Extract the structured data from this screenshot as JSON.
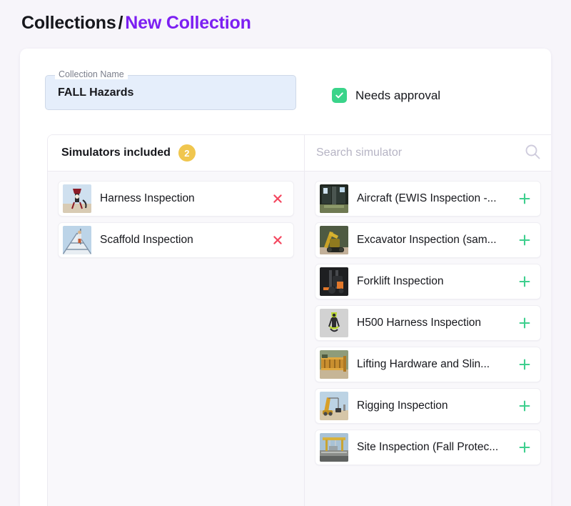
{
  "breadcrumb": {
    "root": "Collections",
    "separator": "/",
    "current": "New Collection"
  },
  "form": {
    "name_field": {
      "label": "Collection Name",
      "value": "FALL Hazards",
      "placeholder": "Collection Name"
    },
    "approval": {
      "label": "Needs approval",
      "checked": true,
      "check_icon": "check-icon"
    }
  },
  "colors": {
    "page_background": "#f7f5fa",
    "accent_purple": "#7c1ff2",
    "badge_amber": "#f0c64e",
    "checkbox_green": "#3ad48a",
    "add_green": "#3ecf8e",
    "remove_red": "#f4475f",
    "field_blue": "#e5eefb"
  },
  "included_panel": {
    "title": "Simulators included",
    "count": "2",
    "remove_icon": "close-icon",
    "items": [
      {
        "label": "Harness Inspection",
        "thumb": "harness-thumb"
      },
      {
        "label": "Scaffold Inspection",
        "thumb": "scaffold-thumb"
      }
    ]
  },
  "available_panel": {
    "search": {
      "placeholder": "Search simulator",
      "value": "",
      "icon": "search-icon"
    },
    "add_icon": "plus-icon",
    "items": [
      {
        "label": "Aircraft (EWIS Inspection -...",
        "thumb": "aircraft-thumb"
      },
      {
        "label": "Excavator Inspection (sam...",
        "thumb": "excavator-thumb"
      },
      {
        "label": "Forklift Inspection",
        "thumb": "forklift-thumb"
      },
      {
        "label": "H500 Harness Inspection",
        "thumb": "h500-thumb"
      },
      {
        "label": "Lifting Hardware and Slin...",
        "thumb": "lifting-thumb"
      },
      {
        "label": "Rigging Inspection",
        "thumb": "rigging-thumb"
      },
      {
        "label": "Site Inspection (Fall Protec...",
        "thumb": "site-thumb"
      }
    ]
  }
}
